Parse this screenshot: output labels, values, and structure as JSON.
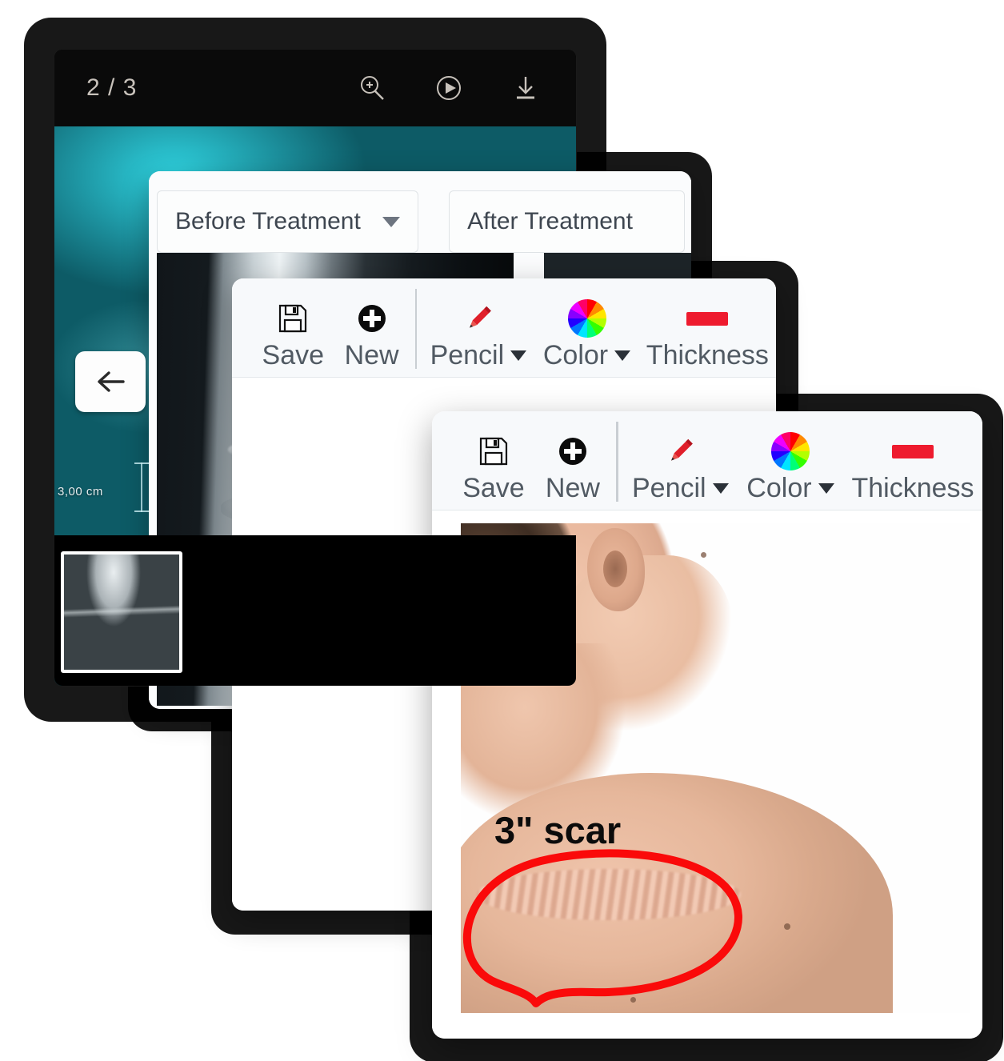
{
  "xray_viewer": {
    "page_counter": "2 / 3",
    "icons": [
      {
        "name": "zoom-in-icon",
        "label": "Zoom In"
      },
      {
        "name": "play-circle-icon",
        "label": "Play"
      },
      {
        "name": "download-icon",
        "label": "Download"
      }
    ],
    "back_button_label": "Back",
    "measurement_label": "3,00 cm",
    "thumbnail_alt": "Knee X-ray thumbnail"
  },
  "compare_window": {
    "dropdowns": [
      {
        "name": "before-treatment-select",
        "value": "Before Treatment",
        "options": [
          "Before Treatment",
          "After Treatment"
        ]
      },
      {
        "name": "after-treatment-select",
        "value": "After Treatment",
        "options": [
          "Before Treatment",
          "After Treatment"
        ]
      }
    ],
    "pane_before_alt": "Lateral knee X-ray before treatment",
    "pane_after_alt": "AP spine X-ray after treatment"
  },
  "toolbar": {
    "save_label": "Save",
    "new_label": "New",
    "pencil_label": "Pencil",
    "color_label": "Color",
    "thickness_label": "Thickness",
    "icons": {
      "save": "floppy-disk-icon",
      "new": "plus-circle-icon",
      "pencil": "pencil-icon",
      "color": "color-wheel-icon",
      "thickness": "thickness-bar-icon"
    },
    "accent_red": "#ee1b2e",
    "label_color": "#515a63"
  },
  "draw_window": {
    "canvas_alt": "Line drawing of shoulder with red X mark",
    "mark_color": "#e8382a",
    "outline_color": "#6e6e6e"
  },
  "photo_window": {
    "canvas_alt": "Photo of neck and shoulder with surgical scar",
    "annotation_text": "3\" scar",
    "annotation_color": "#0b0b0b",
    "circle_color": "#fa0a0a"
  }
}
